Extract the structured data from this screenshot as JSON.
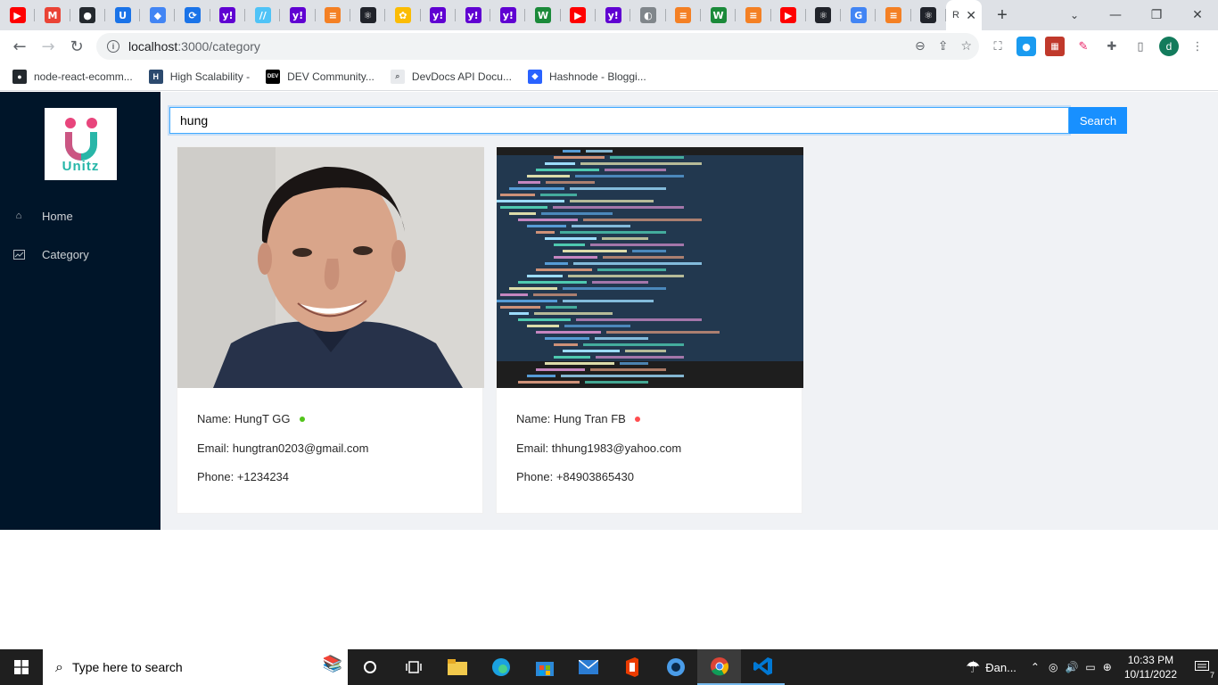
{
  "browser": {
    "pinned_tabs": [
      {
        "icon": "youtube-icon",
        "color": "#ff0000",
        "glyph": "▶"
      },
      {
        "icon": "gmail-icon",
        "color": "#ea4335",
        "glyph": "M"
      },
      {
        "icon": "github-icon",
        "color": "#24292e",
        "glyph": "●"
      },
      {
        "icon": "unitz-icon",
        "color": "#1a73e8",
        "glyph": "U"
      },
      {
        "icon": "devdocs-icon",
        "color": "#4285f4",
        "glyph": "◆"
      },
      {
        "icon": "reload-app-icon",
        "color": "#1a73e8",
        "glyph": "⟳"
      },
      {
        "icon": "yahoo-icon",
        "color": "#6001d2",
        "glyph": "y!"
      },
      {
        "icon": "stripe-icon",
        "color": "#4fc3f7",
        "glyph": "//"
      },
      {
        "icon": "yahoo-icon",
        "color": "#6001d2",
        "glyph": "y!"
      },
      {
        "icon": "stackoverflow-icon",
        "color": "#f48024",
        "glyph": "≡"
      },
      {
        "icon": "react-icon",
        "color": "#20232a",
        "glyph": "⚛"
      },
      {
        "icon": "photos-icon",
        "color": "#fbbc04",
        "glyph": "✿"
      },
      {
        "icon": "yahoo-icon",
        "color": "#6001d2",
        "glyph": "y!"
      },
      {
        "icon": "yahoo-icon",
        "color": "#6001d2",
        "glyph": "y!"
      },
      {
        "icon": "yahoo-icon",
        "color": "#6001d2",
        "glyph": "y!"
      },
      {
        "icon": "w-icon",
        "color": "#1b8a3a",
        "glyph": "W"
      },
      {
        "icon": "youtube-icon",
        "color": "#ff0000",
        "glyph": "▶"
      },
      {
        "icon": "yahoo-icon",
        "color": "#6001d2",
        "glyph": "y!"
      },
      {
        "icon": "globe-icon",
        "color": "#80868b",
        "glyph": "◐"
      },
      {
        "icon": "stackoverflow-icon",
        "color": "#f48024",
        "glyph": "≡"
      },
      {
        "icon": "w-icon",
        "color": "#1b8a3a",
        "glyph": "W"
      },
      {
        "icon": "stackoverflow-icon",
        "color": "#f48024",
        "glyph": "≡"
      },
      {
        "icon": "youtube-icon",
        "color": "#ff0000",
        "glyph": "▶"
      },
      {
        "icon": "react-icon",
        "color": "#20232a",
        "glyph": "⚛"
      },
      {
        "icon": "google-icon",
        "color": "#4285f4",
        "glyph": "G"
      },
      {
        "icon": "stackoverflow-icon",
        "color": "#f48024",
        "glyph": "≡"
      },
      {
        "icon": "react-icon",
        "color": "#20232a",
        "glyph": "⚛"
      }
    ],
    "active_tab_label": "R",
    "url_host": "localhost",
    "url_path": ":3000/category",
    "bookmarks": [
      {
        "label": "node-react-ecomm...",
        "icon": "github-icon"
      },
      {
        "label": "High Scalability -",
        "icon": "highscalability-icon"
      },
      {
        "label": "DEV Community...",
        "icon": "dev-icon"
      },
      {
        "label": "DevDocs API Docu...",
        "icon": "devdocs-icon"
      },
      {
        "label": "Hashnode - Bloggi...",
        "icon": "hashnode-icon"
      }
    ],
    "profile_initial": "d"
  },
  "app": {
    "logo_text": "Unitz",
    "menu": [
      {
        "label": "Home",
        "icon": "home-icon"
      },
      {
        "label": "Category",
        "icon": "chart-icon"
      }
    ],
    "search": {
      "value": "hung",
      "button_label": "Search"
    },
    "cards": [
      {
        "name": "Name: HungT GG",
        "status_color": "#52c41a",
        "email": "Email: hungtran0203@gmail.com",
        "phone": "Phone: +1234234"
      },
      {
        "name": "Name: Hung Tran FB",
        "status_color": "#ff4d4f",
        "email": "Email: thhung1983@yahoo.com",
        "phone": "Phone: +84903865430"
      }
    ]
  },
  "taskbar": {
    "search_placeholder": "Type here to search",
    "weather_label": "Đan...",
    "time": "10:33 PM",
    "date": "10/11/2022",
    "notification_count": "7"
  }
}
